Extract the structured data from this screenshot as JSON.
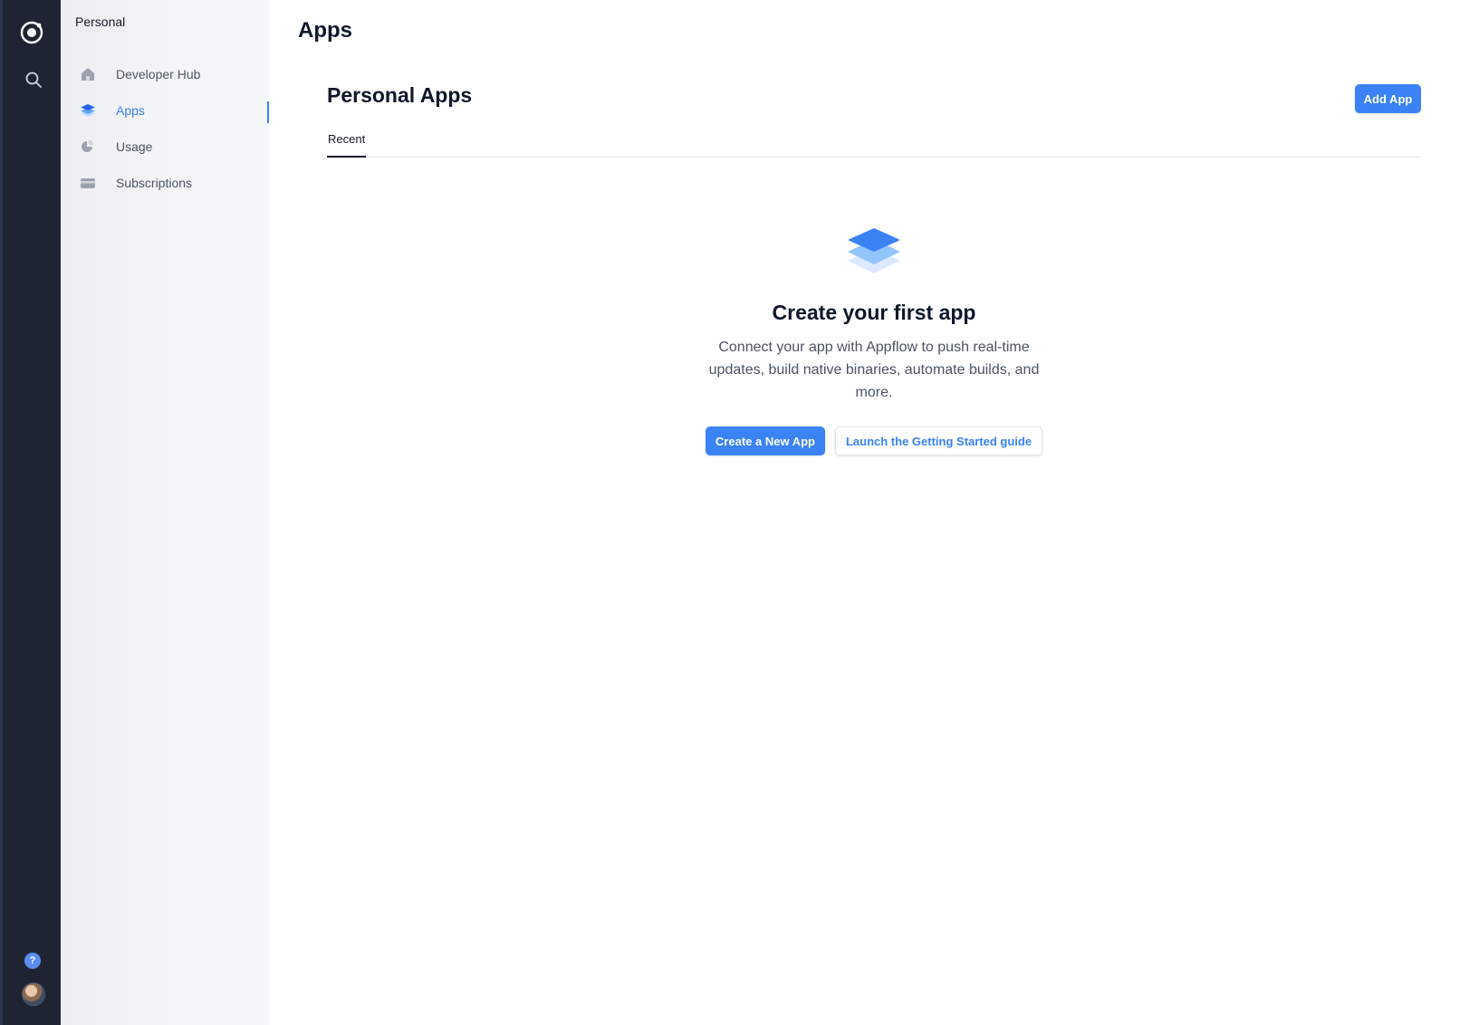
{
  "rail": {
    "logo_icon": "ionic-logo-icon",
    "search_icon": "search-icon",
    "help_label": "?",
    "avatar_icon": "user-avatar"
  },
  "sidebar": {
    "org_name": "Personal",
    "items": [
      {
        "label": "Developer Hub",
        "icon": "home-icon",
        "active": false
      },
      {
        "label": "Apps",
        "icon": "layers-icon",
        "active": true
      },
      {
        "label": "Usage",
        "icon": "pie-chart-icon",
        "active": false
      },
      {
        "label": "Subscriptions",
        "icon": "credit-card-icon",
        "active": false
      }
    ]
  },
  "main": {
    "page_title": "Apps",
    "section_title": "Personal Apps",
    "add_app_label": "Add App",
    "tabs": [
      {
        "label": "Recent",
        "active": true
      }
    ],
    "empty_state": {
      "icon": "layers-stack-icon",
      "heading": "Create your first app",
      "description": "Connect your app with Appflow to push real-time updates, build native binaries, automate builds, and more.",
      "primary_label": "Create a New App",
      "secondary_label": "Launch the Getting Started guide"
    }
  },
  "colors": {
    "accent": "#3b82f6",
    "rail_bg": "#1f2433",
    "sidebar_bg": "#f3f4f7"
  }
}
